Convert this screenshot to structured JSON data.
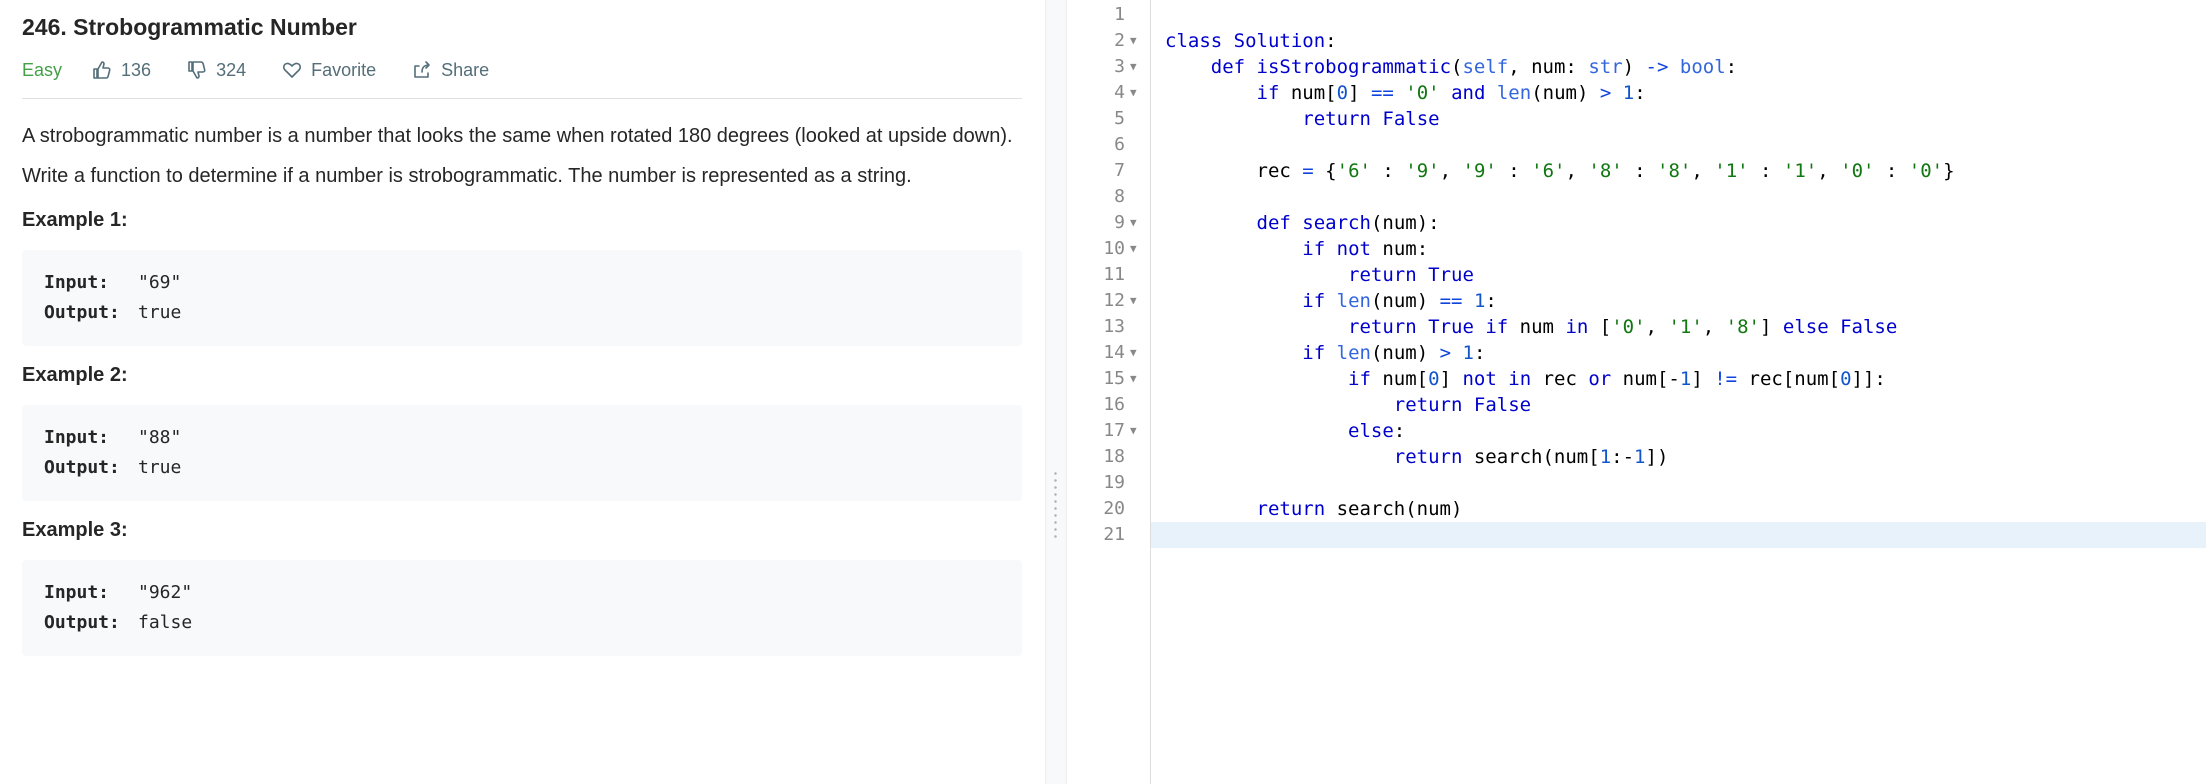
{
  "problem": {
    "title": "246. Strobogrammatic Number",
    "difficulty": "Easy",
    "likes": "136",
    "dislikes": "324",
    "favorite_label": "Favorite",
    "share_label": "Share",
    "description": [
      "A strobogrammatic number is a number that looks the same when rotated 180 degrees (looked at upside down).",
      "Write a function to determine if a number is strobogrammatic. The number is represented as a string."
    ],
    "examples": [
      {
        "title": "Example 1:",
        "input_label": "Input:",
        "input": "\"69\"",
        "output_label": "Output:",
        "output": "true"
      },
      {
        "title": "Example 2:",
        "input_label": "Input:",
        "input": "\"88\"",
        "output_label": "Output:",
        "output": "true"
      },
      {
        "title": "Example 3:",
        "input_label": "Input:",
        "input": "\"962\"",
        "output_label": "Output:",
        "output": "false"
      }
    ]
  },
  "editor": {
    "active_line": 21,
    "lines": [
      {
        "n": "1",
        "fold": false,
        "code": ""
      },
      {
        "n": "2",
        "fold": true,
        "code": "class Solution:"
      },
      {
        "n": "3",
        "fold": true,
        "code": "    def isStrobogrammatic(self, num: str) -> bool:"
      },
      {
        "n": "4",
        "fold": true,
        "code": "        if num[0] == '0' and len(num) > 1:"
      },
      {
        "n": "5",
        "fold": false,
        "code": "            return False"
      },
      {
        "n": "6",
        "fold": false,
        "code": ""
      },
      {
        "n": "7",
        "fold": false,
        "code": "        rec = {'6' : '9', '9' : '6', '8' : '8', '1' : '1', '0' : '0'}"
      },
      {
        "n": "8",
        "fold": false,
        "code": ""
      },
      {
        "n": "9",
        "fold": true,
        "code": "        def search(num):"
      },
      {
        "n": "10",
        "fold": true,
        "code": "            if not num:"
      },
      {
        "n": "11",
        "fold": false,
        "code": "                return True"
      },
      {
        "n": "12",
        "fold": true,
        "code": "            if len(num) == 1:"
      },
      {
        "n": "13",
        "fold": false,
        "code": "                return True if num in ['0', '1', '8'] else False"
      },
      {
        "n": "14",
        "fold": true,
        "code": "            if len(num) > 1:"
      },
      {
        "n": "15",
        "fold": true,
        "code": "                if num[0] not in rec or num[-1] != rec[num[0]]:"
      },
      {
        "n": "16",
        "fold": false,
        "code": "                    return False"
      },
      {
        "n": "17",
        "fold": true,
        "code": "                else:"
      },
      {
        "n": "18",
        "fold": false,
        "code": "                    return search(num[1:-1])"
      },
      {
        "n": "19",
        "fold": false,
        "code": ""
      },
      {
        "n": "20",
        "fold": false,
        "code": "        return search(num)"
      },
      {
        "n": "21",
        "fold": false,
        "code": ""
      }
    ]
  },
  "colors": {
    "difficulty_easy": "#43a047",
    "keyword": "#0000cc",
    "string": "#117711",
    "number": "#1155cc",
    "active_line_bg": "#e8f2fb"
  },
  "icons": [
    "thumbs-up-icon",
    "thumbs-down-icon",
    "heart-icon",
    "share-icon",
    "fold-arrow-icon"
  ]
}
